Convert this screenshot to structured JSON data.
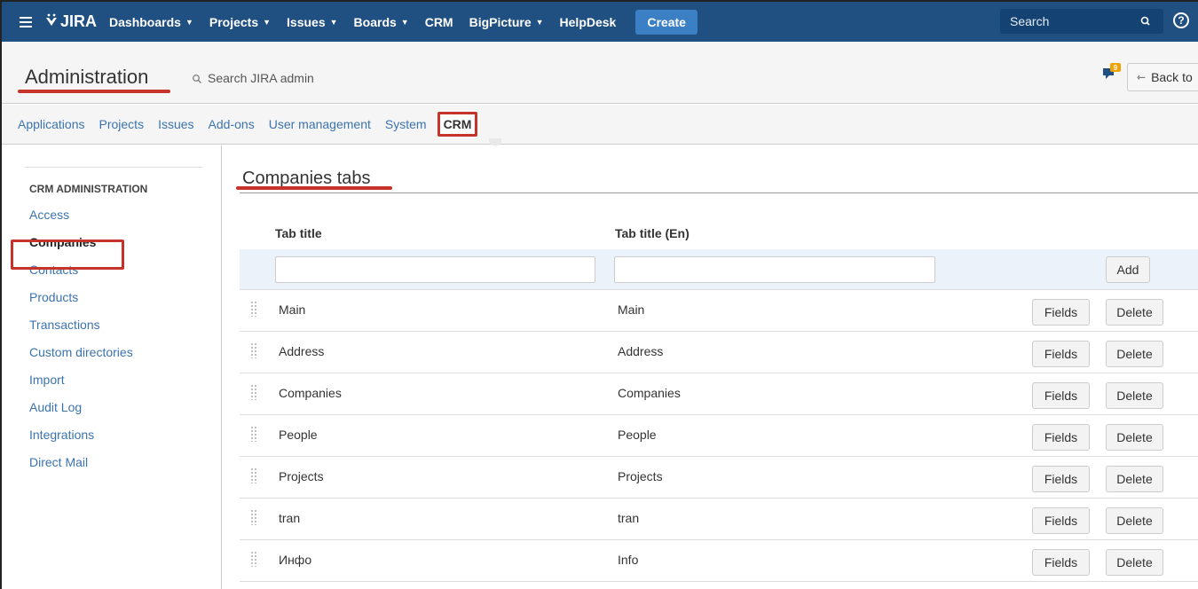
{
  "topnav": {
    "logo_text": "JIRA",
    "items": [
      {
        "label": "Dashboards",
        "dropdown": true
      },
      {
        "label": "Projects",
        "dropdown": true
      },
      {
        "label": "Issues",
        "dropdown": true
      },
      {
        "label": "Boards",
        "dropdown": true
      },
      {
        "label": "CRM",
        "dropdown": false
      },
      {
        "label": "BigPicture",
        "dropdown": true
      },
      {
        "label": "HelpDesk",
        "dropdown": false
      }
    ],
    "create_label": "Create",
    "search_placeholder": "Search",
    "help_label": "?"
  },
  "admin_header": {
    "title": "Administration",
    "search_label": "Search JIRA admin",
    "feedback_badge": "9",
    "back_label": "Back to"
  },
  "admin_tabs": [
    {
      "label": "Applications",
      "active": false
    },
    {
      "label": "Projects",
      "active": false
    },
    {
      "label": "Issues",
      "active": false
    },
    {
      "label": "Add-ons",
      "active": false
    },
    {
      "label": "User management",
      "active": false
    },
    {
      "label": "System",
      "active": false
    },
    {
      "label": "CRM",
      "active": true
    }
  ],
  "sidebar": {
    "heading": "CRM ADMINISTRATION",
    "items": [
      {
        "label": "Access",
        "active": false
      },
      {
        "label": "Companies",
        "active": true
      },
      {
        "label": "Contacts",
        "active": false
      },
      {
        "label": "Products",
        "active": false
      },
      {
        "label": "Transactions",
        "active": false
      },
      {
        "label": "Custom directories",
        "active": false
      },
      {
        "label": "Import",
        "active": false
      },
      {
        "label": "Audit Log",
        "active": false
      },
      {
        "label": "Integrations",
        "active": false
      },
      {
        "label": "Direct Mail",
        "active": false
      }
    ]
  },
  "main": {
    "title": "Companies tabs",
    "columns": {
      "tab_title": "Tab title",
      "tab_title_en": "Tab title (En)"
    },
    "new_row": {
      "tab_title_value": "",
      "tab_title_en_value": "",
      "add_label": "Add"
    },
    "fields_label": "Fields",
    "delete_label": "Delete",
    "rows": [
      {
        "title": "Main",
        "title_en": "Main"
      },
      {
        "title": "Address",
        "title_en": "Address"
      },
      {
        "title": "Companies",
        "title_en": "Companies"
      },
      {
        "title": "People",
        "title_en": "People"
      },
      {
        "title": "Projects",
        "title_en": "Projects"
      },
      {
        "title": "tran",
        "title_en": "tran"
      },
      {
        "title": "Инфо",
        "title_en": "Info"
      }
    ]
  },
  "colors": {
    "nav_bg": "#205081",
    "link": "#3b73af",
    "create_bg": "#3b7fc4",
    "highlight_red": "#c5332a",
    "input_row_bg": "#ebf2f9"
  }
}
